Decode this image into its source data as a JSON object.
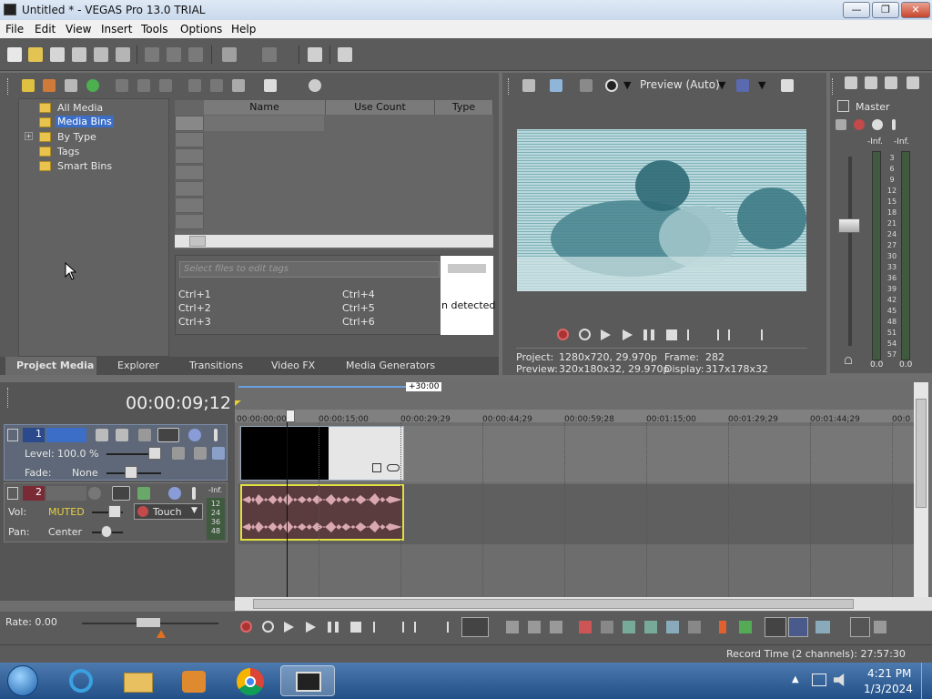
{
  "window": {
    "title": "Untitled * - VEGAS Pro 13.0 TRIAL",
    "minimize": "—",
    "maximize": "❐",
    "close": "✕"
  },
  "menu": [
    "File",
    "Edit",
    "View",
    "Insert",
    "Tools",
    "Options",
    "Help"
  ],
  "project_media": {
    "tree": [
      "All Media",
      "Media Bins",
      "By Type",
      "Tags",
      "Smart Bins"
    ],
    "expand_glyph": "+",
    "columns": [
      "Name",
      "Use Count",
      "Type"
    ],
    "tag_placeholder": "Select files to edit tags",
    "shortcuts": [
      "Ctrl+1",
      "Ctrl+2",
      "Ctrl+3",
      "Ctrl+4",
      "Ctrl+5",
      "Ctrl+6"
    ],
    "detected_text": "n detected",
    "tabs": [
      "Project Media",
      "Explorer",
      "Transitions",
      "Video FX",
      "Media Generators"
    ]
  },
  "preview": {
    "mode": "Preview (Auto)",
    "project_label": "Project:",
    "project_value": "1280x720, 29.970p",
    "frame_label": "Frame:",
    "frame_value": "282",
    "preview_label": "Preview:",
    "preview_value": "320x180x32, 29.970p",
    "display_label": "Display:",
    "display_value": "317x178x32"
  },
  "master": {
    "label": "Master",
    "inf_left": "-Inf.",
    "inf_right": "-Inf.",
    "scale": [
      "3",
      "6",
      "9",
      "12",
      "15",
      "18",
      "21",
      "24",
      "27",
      "30",
      "33",
      "36",
      "39",
      "42",
      "45",
      "48",
      "51",
      "54",
      "57"
    ],
    "val_left": "0.0",
    "val_right": "0.0"
  },
  "timeline": {
    "timecode": "00:00:09;12",
    "loop_region": "+30:00",
    "ruler": [
      "00:00:00;00",
      "00:00:15;00",
      "00:00:29;29",
      "00:00:44;29",
      "00:00:59;28",
      "00:01:15;00",
      "00:01:29;29",
      "00:01:44;29",
      "00:0"
    ],
    "video_track": {
      "number": "1",
      "level_label": "Level:",
      "level_value": "100.0 %",
      "fade_label": "Fade:",
      "fade_value": "None"
    },
    "audio_track": {
      "number": "2",
      "vol_label": "Vol:",
      "vol_value": "MUTED",
      "pan_label": "Pan:",
      "pan_value": "Center",
      "automation": "Touch",
      "inf": "-Inf.",
      "meter": [
        "12",
        "24",
        "36",
        "48"
      ]
    }
  },
  "bottom": {
    "rate": "Rate: 0.00",
    "record_time": "Record Time (2 channels): 27:57:30"
  },
  "taskbar": {
    "time": "4:21 PM",
    "date": "1/3/2024"
  },
  "colors": {
    "panel": "#5a5a5a",
    "timeline_bg": "#6d6d6d",
    "selection": "#3c6ec8",
    "clip_border": "#e0e040",
    "audio_clip": "#5a3b3e",
    "muted": "#e8d040",
    "taskbar": "#2a5a92"
  }
}
